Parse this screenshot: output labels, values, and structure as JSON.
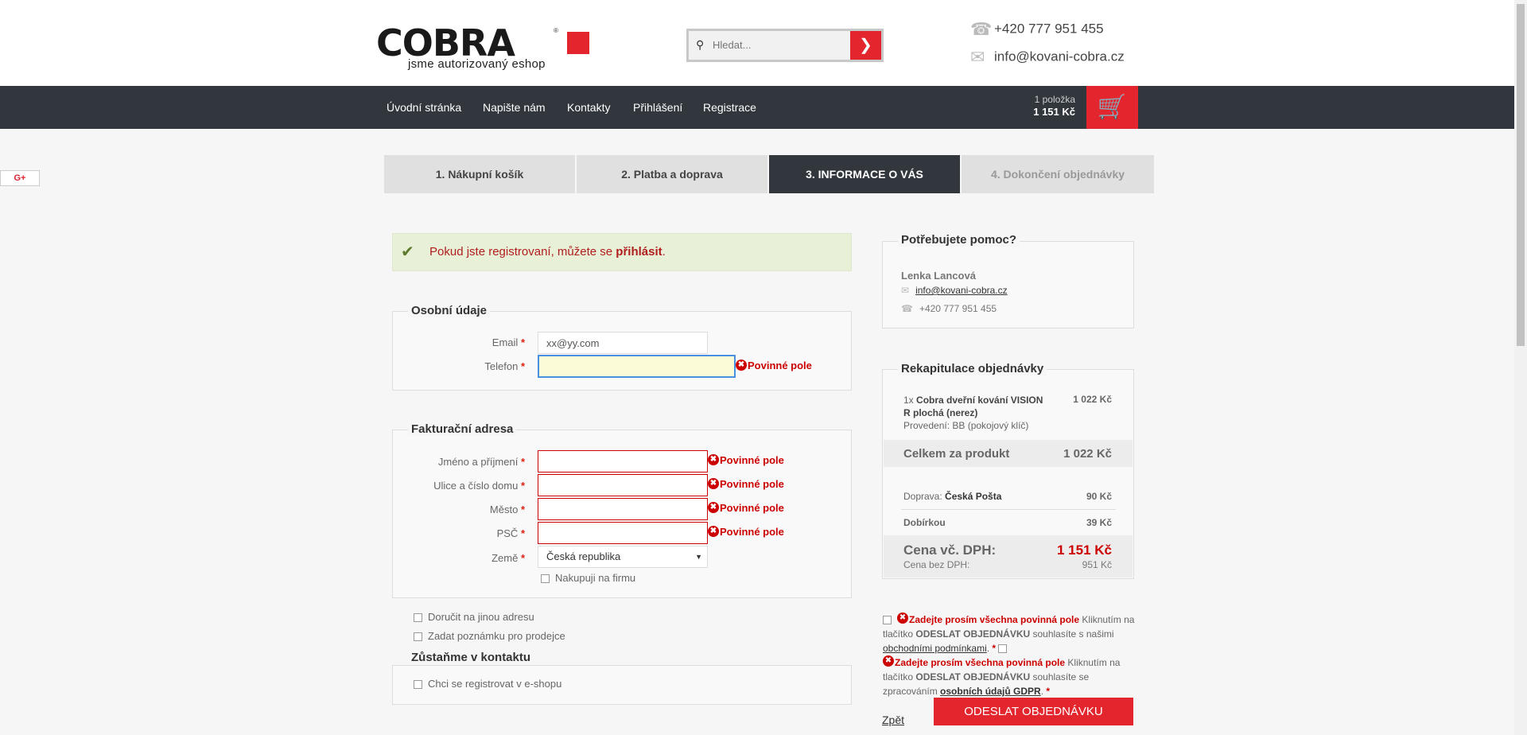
{
  "header": {
    "logo_text": "COBRA",
    "logo_reg": "®",
    "tagline": "jsme autorizovaný eshop",
    "search_placeholder": "Hledat...",
    "phone": "+420 777 951 455",
    "email": "info@kovani-cobra.cz"
  },
  "nav": {
    "items": [
      "Úvodní stránka",
      "Napište nám",
      "Kontakty",
      "Přihlášení",
      "Registrace"
    ],
    "cart_count": "1 položka",
    "cart_total": "1 151 Kč"
  },
  "social": {
    "gplus": "G+"
  },
  "steps": [
    "1. Nákupní košík",
    "2. Platba a doprava",
    "3. INFORMACE O VÁS",
    "4. Dokončení objednávky"
  ],
  "alert": {
    "text": "Pokud jste registrovaní, můžete se ",
    "link": "přihlásit",
    "end": "."
  },
  "personal": {
    "legend": "Osobní údaje",
    "email_label": "Email",
    "email_value": "xx@yy.com",
    "phone_label": "Telefon",
    "required_msg": "Povinné pole"
  },
  "billing": {
    "legend": "Fakturační adresa",
    "name_label": "Jméno a příjmení",
    "street_label": "Ulice a číslo domu",
    "city_label": "Město",
    "zip_label": "PSČ",
    "country_label": "Země",
    "country_value": "Česká republika",
    "company_cb": "Nakupuji na firmu"
  },
  "extra": {
    "other_address": "Doručit na jinou adresu",
    "note": "Zadat poznámku pro prodejce"
  },
  "contact_keep": {
    "legend": "Zůstaňme v kontaktu",
    "register": "Chci se registrovat v e-shopu"
  },
  "required_star": "*",
  "help": {
    "title": "Potřebujete pomoc?",
    "name": "Lenka Lancová",
    "email": "info@kovani-cobra.cz",
    "phone": "+420 777 951 455"
  },
  "summary": {
    "title": "Rekapitulace objednávky",
    "item_qty": "1x",
    "item_name": "Cobra dveřní kování VISION R plochá (nerez)",
    "item_variant": "Provedení: BB (pokojový klíč)",
    "item_price": "1 022 Kč",
    "product_total_label": "Celkem za produkt",
    "product_total": "1 022 Kč",
    "shipping_label": "Doprava: ",
    "shipping_name": "Česká Pošta",
    "shipping_price": "90 Kč",
    "cod_label": "Dobírkou",
    "cod_price": "39 Kč",
    "total_label": "Cena vč. DPH:",
    "total": "1 151 Kč",
    "total_novat_label": "Cena bez DPH:",
    "total_novat": "951 Kč"
  },
  "terms": {
    "err": "Zadejte prosím všechna povinná pole",
    "t1a": " Kliknutím na tlačítko ",
    "btn_name": "ODESLAT OBJEDNÁVKU",
    "t1b": " souhlasíte s našimi ",
    "t1link": "obchodními podmínkami",
    "t2b": " souhlasíte se zpracováním ",
    "t2link": "osobních údajů GDPR"
  },
  "actions": {
    "back": "Zpět",
    "submit": "ODESLAT OBJEDNÁVKU"
  }
}
